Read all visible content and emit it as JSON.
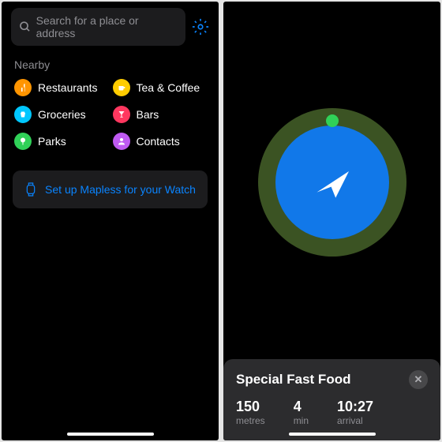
{
  "left": {
    "search": {
      "placeholder": "Search for a place or address"
    },
    "nearby": {
      "title": "Nearby",
      "items": [
        {
          "label": "Restaurants"
        },
        {
          "label": "Tea & Coffee"
        },
        {
          "label": "Groceries"
        },
        {
          "label": "Bars"
        },
        {
          "label": "Parks"
        },
        {
          "label": "Contacts"
        }
      ]
    },
    "watch_banner": "Set up Mapless for your Watch"
  },
  "right": {
    "destination": "Special Fast Food",
    "stats": [
      {
        "value": "150",
        "label": "metres"
      },
      {
        "value": "4",
        "label": "min"
      },
      {
        "value": "10:27",
        "label": "arrival"
      }
    ]
  }
}
